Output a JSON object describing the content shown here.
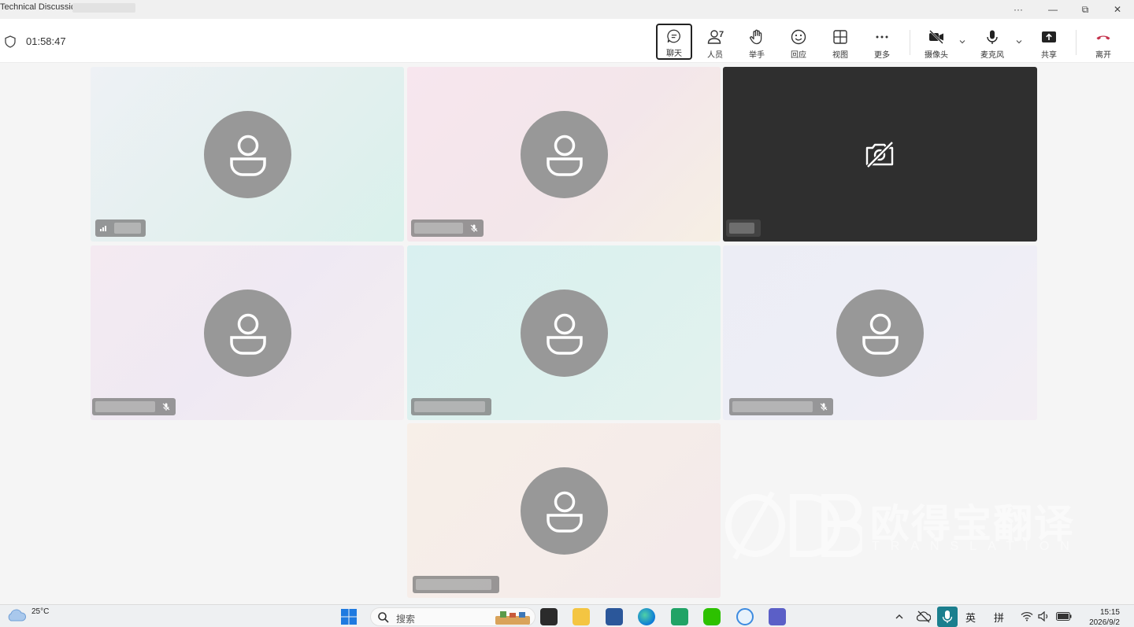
{
  "window": {
    "title": "Technical Discussic",
    "controls": {
      "more": "···",
      "minimize": "—",
      "restore": "⧉",
      "close": "✕"
    }
  },
  "meeting": {
    "duration": "01:58:47"
  },
  "toolbar": {
    "chat_label": "聊天",
    "people_label": "人员",
    "people_count": "7",
    "raise_hand_label": "举手",
    "react_label": "回应",
    "view_label": "视图",
    "more_label": "更多",
    "camera_label": "摄像头",
    "mic_label": "麦克风",
    "share_label": "共享",
    "leave_label": "离开"
  },
  "participants": [
    {
      "camera": "off-avatar",
      "audio": "speaking"
    },
    {
      "camera": "off-avatar",
      "audio": "muted"
    },
    {
      "camera": "off-dark",
      "audio": "none"
    },
    {
      "camera": "off-avatar",
      "audio": "muted"
    },
    {
      "camera": "off-avatar",
      "audio": "none"
    },
    {
      "camera": "off-avatar",
      "audio": "muted"
    },
    {
      "camera": "off-avatar",
      "audio": "none"
    }
  ],
  "watermark": {
    "brand": "欧得宝翻译",
    "sub": "TRANSLATION",
    "logo": "ODB"
  },
  "taskbar": {
    "weather_temp": "25°C",
    "search_placeholder": "搜索",
    "ime_lang": "英",
    "ime_mode": "拼",
    "time": "15:15",
    "date": "2026/9/2"
  },
  "colors": {
    "avatar": "#989898",
    "dark_tile": "#2f2f2f",
    "hangup": "#c4314b"
  }
}
